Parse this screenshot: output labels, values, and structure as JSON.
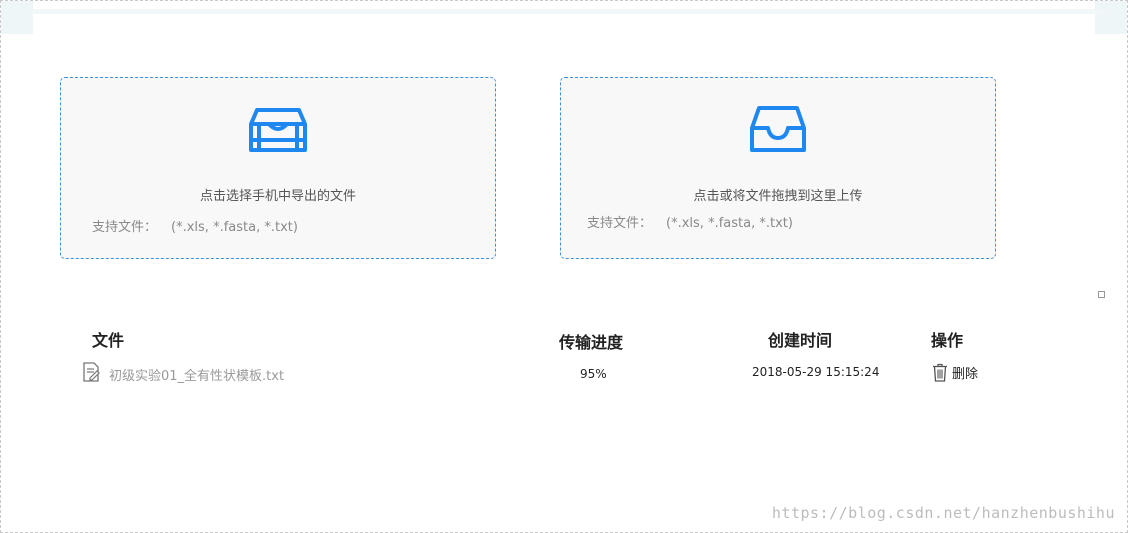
{
  "upload_panels": {
    "phone": {
      "title": "点击选择手机中导出的文件",
      "support_label": "支持文件：",
      "formats": "(*.xls, *.fasta, *.txt)",
      "icon": "archive-box-icon"
    },
    "drop": {
      "title": "点击或将文件拖拽到这里上传",
      "support_label": "支持文件：",
      "formats": "(*.xls, *.fasta, *.txt)",
      "icon": "inbox-tray-icon"
    }
  },
  "table": {
    "headers": {
      "file": "文件",
      "progress": "传输进度",
      "created": "创建时间",
      "actions": "操作"
    },
    "rows": [
      {
        "file_name": "初级实验01_全有性状模板.txt",
        "progress": "95%",
        "created": "2018-05-29 15:15:24",
        "delete_label": "删除"
      }
    ]
  },
  "watermark": "https://blog.csdn.net/hanzhenbushihu",
  "colors": {
    "accent": "#1e88f0",
    "dashed_border": "#3d8fe0",
    "panel_bg": "#f8f8f8"
  }
}
